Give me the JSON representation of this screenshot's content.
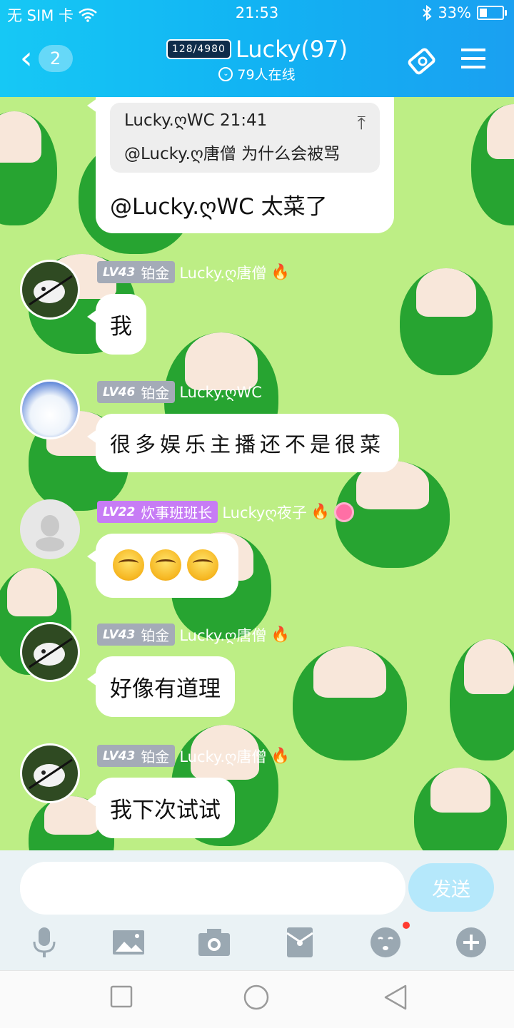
{
  "status": {
    "carrier": "无 SIM 卡",
    "time": "21:53",
    "battery_pct": "33%",
    "battery_level": 0.33
  },
  "header": {
    "back_count": "2",
    "level_badge": "128/4980",
    "title": "Lucky(97)",
    "online": "79人在线"
  },
  "messages": {
    "m0": {
      "quote_header": "Lucky.ღWC 21:41",
      "quote_text": "@Lucky.ღ唐僧 为什么会被骂",
      "text": "@Lucky.ღWC 太菜了"
    },
    "m1": {
      "lv": "LV43",
      "rank": "铂金",
      "name": "Lucky.ღ唐僧",
      "text": "我"
    },
    "m2": {
      "lv": "LV46",
      "rank": "铂金",
      "name": "Lucky.ღWC",
      "text": "很多娱乐主播还不是很菜"
    },
    "m3": {
      "lv": "LV22",
      "rank": "炊事班班长",
      "name": "Luckyღ夜子",
      "emoji_count": 3
    },
    "m4": {
      "lv": "LV43",
      "rank": "铂金",
      "name": "Lucky.ღ唐僧",
      "text": "好像有道理"
    },
    "m5": {
      "lv": "LV43",
      "rank": "铂金",
      "name": "Lucky.ღ唐僧",
      "text": "我下次试试"
    }
  },
  "input": {
    "placeholder": "",
    "send_label": "发送"
  },
  "toolbar": {
    "items": [
      "microphone-icon",
      "image-icon",
      "camera-icon",
      "red-packet-icon",
      "emoji-icon",
      "plus-icon"
    ]
  },
  "colors": {
    "header_start": "#16c8f5",
    "header_end": "#1aa0f1",
    "chat_bg": "#bdee85",
    "send_btn": "#b5e8fb",
    "tag_gray": "#a4abb7",
    "tag_purple": "#c77cf5"
  }
}
